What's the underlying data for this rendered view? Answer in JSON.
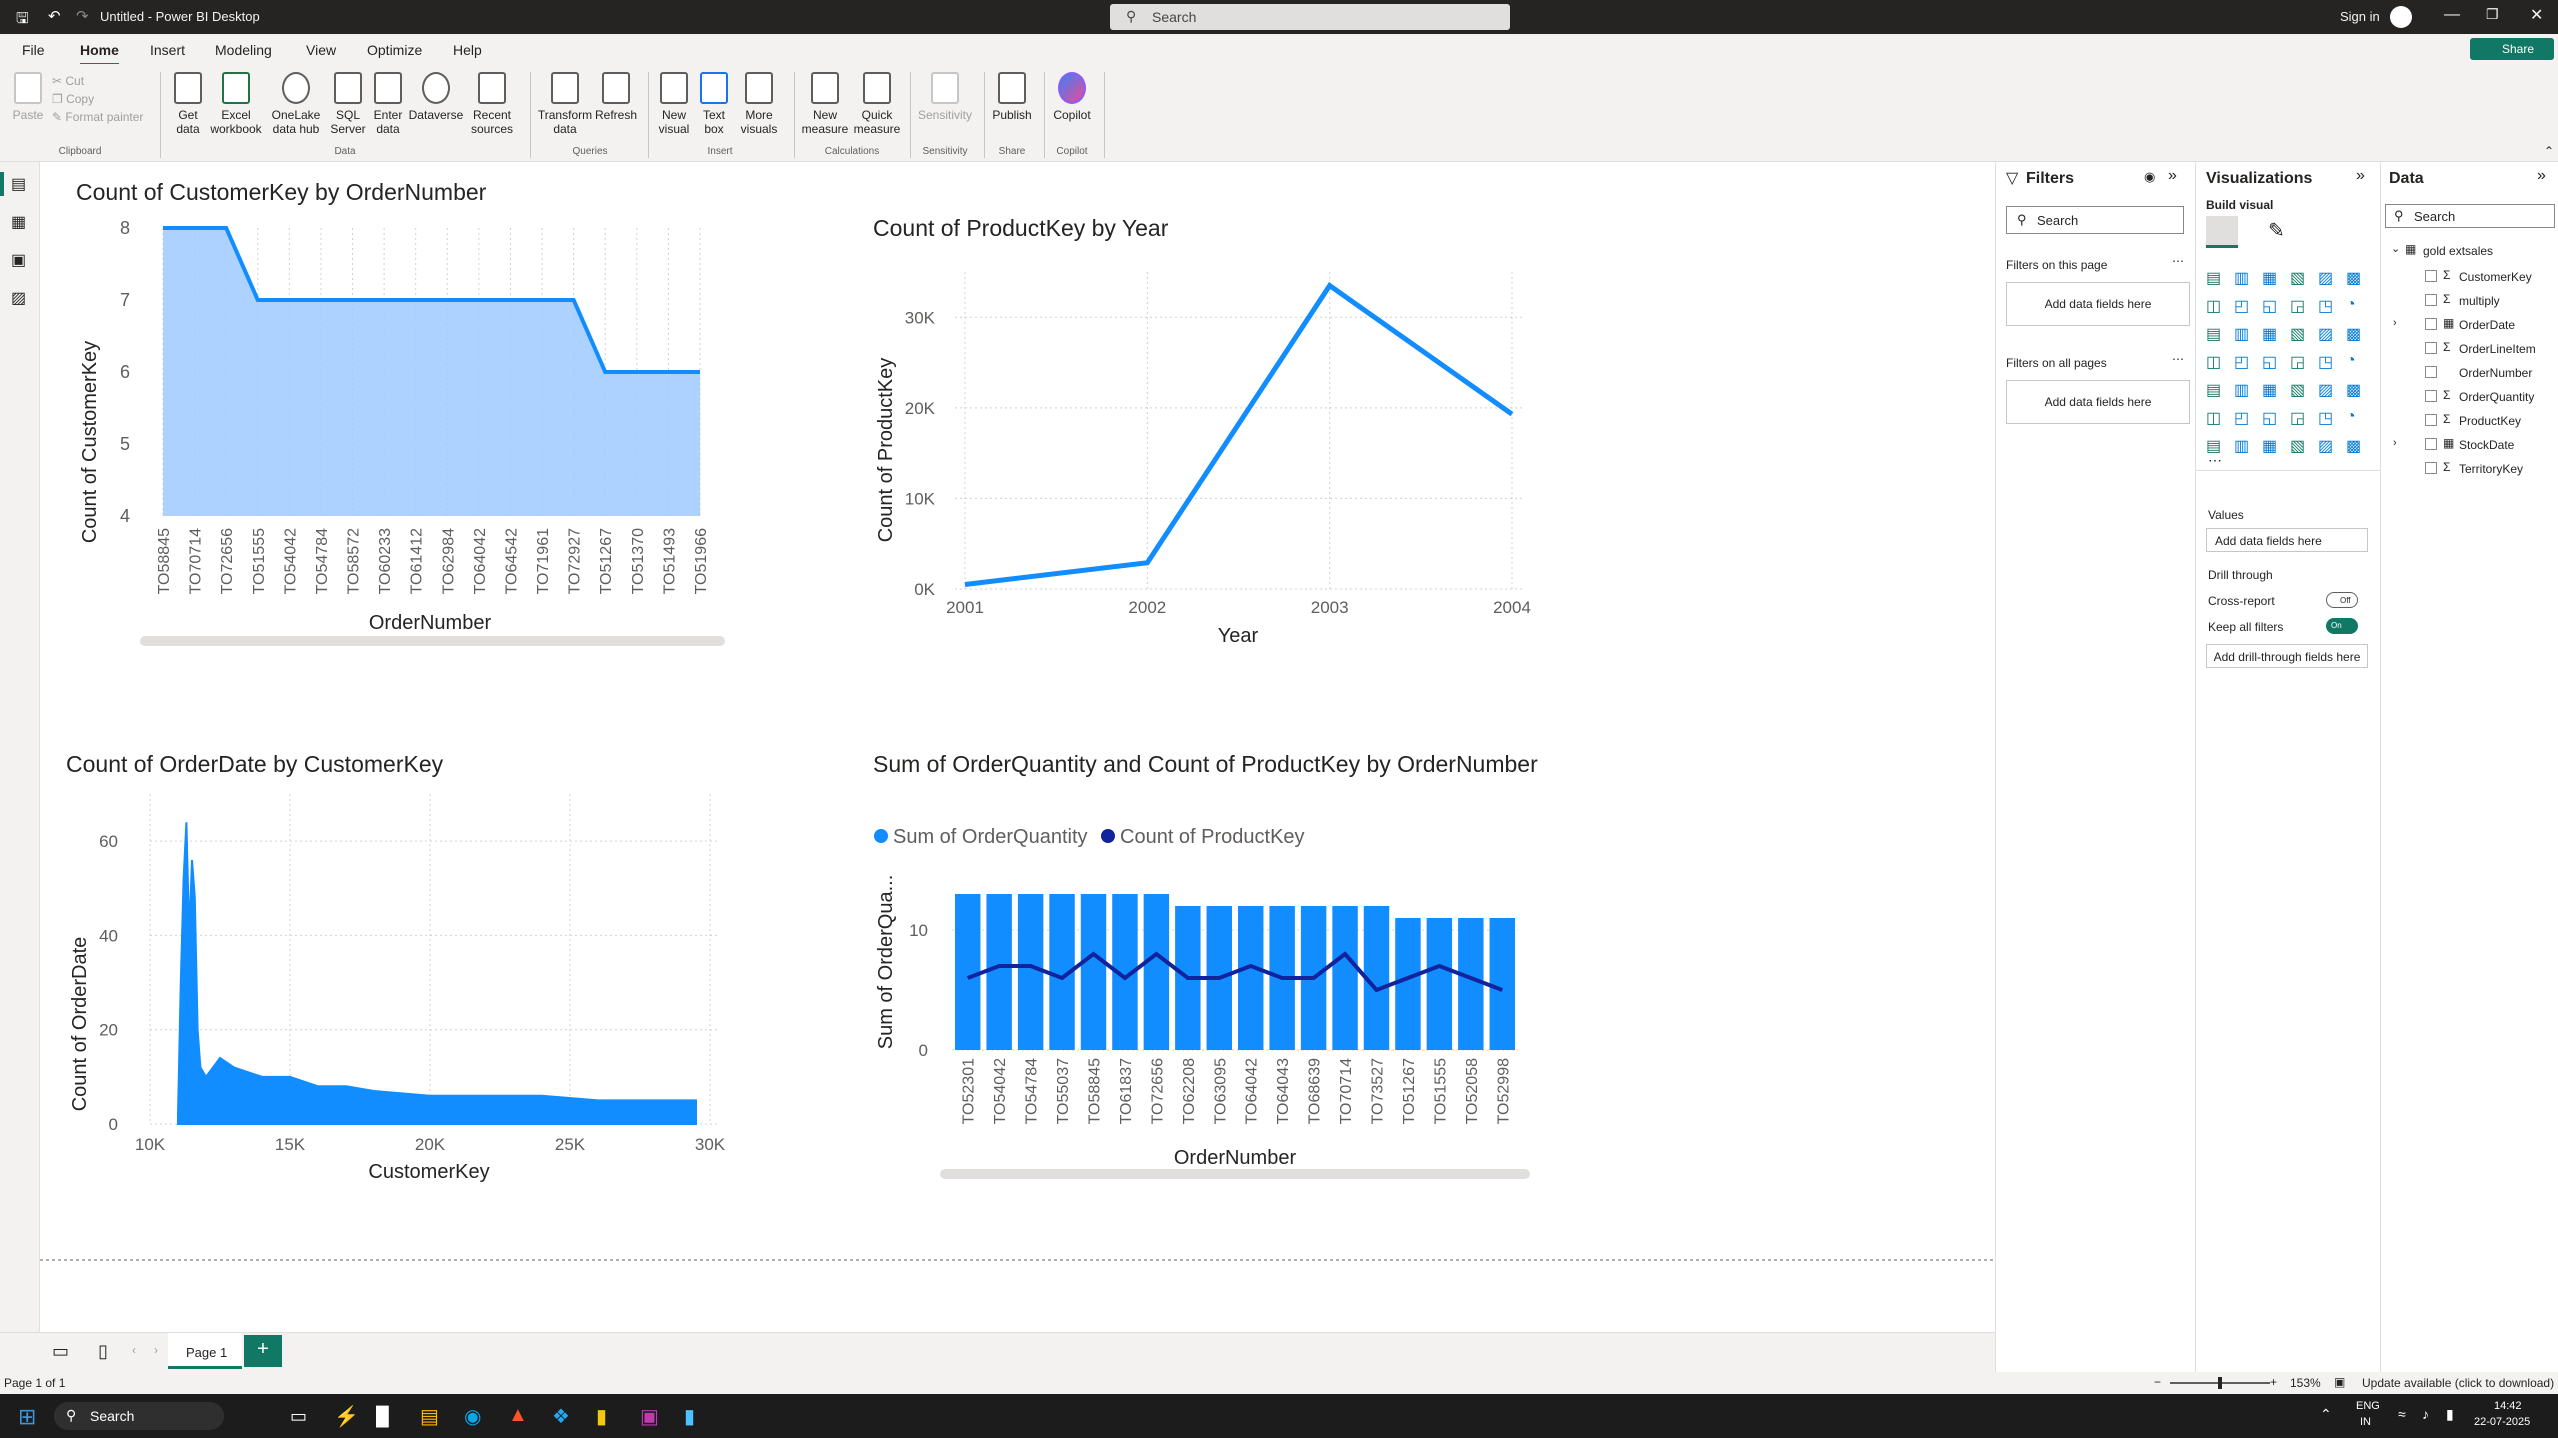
{
  "window": {
    "title": "Untitled - Power BI Desktop",
    "search_placeholder": "Search",
    "sign_in": "Sign in",
    "share": "Share"
  },
  "menu": [
    "File",
    "Home",
    "Insert",
    "Modeling",
    "View",
    "Optimize",
    "Help"
  ],
  "ribbon": {
    "clipboard": {
      "paste": "Paste",
      "cut": "Cut",
      "copy": "Copy",
      "format_painter": "Format painter",
      "group": "Clipboard"
    },
    "data": {
      "items": [
        "Get data",
        "Excel workbook",
        "OneLake data hub",
        "SQL Server",
        "Enter data",
        "Dataverse",
        "Recent sources"
      ],
      "group": "Data"
    },
    "queries": {
      "items": [
        "Transform data",
        "Refresh"
      ],
      "group": "Queries"
    },
    "insert": {
      "items": [
        "New visual",
        "Text box",
        "More visuals"
      ],
      "group": "Insert"
    },
    "calculations": {
      "items": [
        "New measure",
        "Quick measure"
      ],
      "group": "Calculations"
    },
    "sensitivity": {
      "items": [
        "Sensitivity"
      ],
      "group": "Sensitivity"
    },
    "share": {
      "items": [
        "Publish"
      ],
      "group": "Share"
    },
    "copilot": {
      "items": [
        "Copilot"
      ],
      "group": "Copilot"
    }
  },
  "charts": {
    "c1": {
      "title": "Count of CustomerKey by OrderNumber",
      "xlabel": "OrderNumber",
      "ylabel": "Count of CustomerKey",
      "yticks": [
        "8",
        "7",
        "6",
        "5",
        "4"
      ]
    },
    "c2": {
      "title": "Count of ProductKey by Year",
      "xlabel": "Year",
      "ylabel": "Count of ProductKey",
      "yticks": [
        "30K",
        "20K",
        "10K",
        "0K"
      ],
      "xticks": [
        "2001",
        "2002",
        "2003",
        "2004"
      ]
    },
    "c3": {
      "title": "Count of OrderDate by CustomerKey",
      "xlabel": "CustomerKey",
      "ylabel": "Count of OrderDate",
      "yticks": [
        "60",
        "40",
        "20",
        "0"
      ],
      "xticks": [
        "10K",
        "15K",
        "20K",
        "25K",
        "30K"
      ]
    },
    "c4": {
      "title": "Sum of OrderQuantity and Count of ProductKey by OrderNumber",
      "xlabel": "OrderNumber",
      "ylabel": "Sum of OrderQua...",
      "yticks": [
        "10",
        "0"
      ],
      "legend": [
        "Sum of OrderQuantity",
        "Count of ProductKey"
      ]
    }
  },
  "chart_data": [
    {
      "type": "area",
      "title": "Count of CustomerKey by OrderNumber",
      "xlabel": "OrderNumber",
      "ylabel": "Count of CustomerKey",
      "categories": [
        "TO58845",
        "TO70714",
        "TO72656",
        "TO51555",
        "TO54042",
        "TO54784",
        "TO58572",
        "TO60233",
        "TO61412",
        "TO62984",
        "TO64042",
        "TO64542",
        "TO71961",
        "TO72927",
        "TO51267",
        "TO51370",
        "TO51493",
        "TO51966"
      ],
      "values": [
        8,
        8,
        8,
        7,
        7,
        7,
        7,
        7,
        7,
        7,
        7,
        7,
        7,
        7,
        6,
        6,
        6,
        6
      ],
      "ylim": [
        4,
        8
      ]
    },
    {
      "type": "line",
      "title": "Count of ProductKey by Year",
      "xlabel": "Year",
      "ylabel": "Count of ProductKey",
      "x": [
        2001,
        2002,
        2003,
        2004
      ],
      "values": [
        500,
        2900,
        33500,
        19300
      ],
      "ylim": [
        0,
        35000
      ]
    },
    {
      "type": "area",
      "title": "Count of OrderDate by CustomerKey",
      "xlabel": "CustomerKey",
      "ylabel": "Count of OrderDate",
      "x": [
        11000,
        11100,
        11200,
        11300,
        11400,
        11500,
        11600,
        11700,
        11800,
        12000,
        12500,
        13000,
        13500,
        14000,
        15000,
        16000,
        17000,
        18000,
        20000,
        22000,
        24000,
        26000,
        28000,
        29500
      ],
      "values": [
        2,
        30,
        52,
        64,
        40,
        56,
        48,
        20,
        12,
        10,
        14,
        12,
        11,
        10,
        10,
        8,
        8,
        7,
        6,
        6,
        6,
        5,
        5,
        5
      ],
      "xlim": [
        10000,
        30000
      ],
      "ylim": [
        0,
        70
      ]
    },
    {
      "type": "bar",
      "title": "Sum of OrderQuantity and Count of ProductKey by OrderNumber",
      "xlabel": "OrderNumber",
      "ylabel": "Sum of OrderQua...",
      "categories": [
        "TO52301",
        "TO54042",
        "TO54784",
        "TO55037",
        "TO58845",
        "TO61837",
        "TO72656",
        "TO62208",
        "TO63095",
        "TO64042",
        "TO64043",
        "TO68639",
        "TO70714",
        "TO73527",
        "TO51267",
        "TO51555",
        "TO52058",
        "TO52998"
      ],
      "series": [
        {
          "name": "Sum of OrderQuantity",
          "values": [
            13,
            13,
            13,
            13,
            13,
            13,
            13,
            12,
            12,
            12,
            12,
            12,
            12,
            12,
            11,
            11,
            11,
            11
          ]
        },
        {
          "name": "Count of ProductKey",
          "values": [
            6,
            7,
            7,
            6,
            8,
            6,
            8,
            6,
            6,
            7,
            6,
            6,
            8,
            5,
            6,
            7,
            6,
            5
          ]
        }
      ],
      "ylim": [
        0,
        14
      ]
    }
  ],
  "filters": {
    "title": "Filters",
    "search": "Search",
    "on_page": "Filters on this page",
    "on_all": "Filters on all pages",
    "add": "Add data fields here"
  },
  "viz": {
    "title": "Visualizations",
    "build": "Build visual",
    "values": "Values",
    "add_values": "Add data fields here",
    "drill": "Drill through",
    "cross": "Cross-report",
    "cross_state": "Off",
    "keep": "Keep all filters",
    "keep_state": "On",
    "add_drill": "Add drill-through fields here"
  },
  "data": {
    "title": "Data",
    "search": "Search",
    "table": "gold extsales",
    "fields": [
      {
        "name": "CustomerKey",
        "sigma": true
      },
      {
        "name": "multiply",
        "sigma": true
      },
      {
        "name": "OrderDate",
        "sigma": false,
        "expand": true
      },
      {
        "name": "OrderLineItem",
        "sigma": true
      },
      {
        "name": "OrderNumber",
        "sigma": false
      },
      {
        "name": "OrderQuantity",
        "sigma": true
      },
      {
        "name": "ProductKey",
        "sigma": true
      },
      {
        "name": "StockDate",
        "sigma": false,
        "expand": true
      },
      {
        "name": "TerritoryKey",
        "sigma": true
      }
    ]
  },
  "pages": {
    "tab": "Page 1",
    "status": "Page 1 of 1"
  },
  "status": {
    "zoom": "153%",
    "update": "Update available (click to download)"
  },
  "taskbar": {
    "search": "Search",
    "lang": "ENG",
    "region": "IN",
    "time": "14:42",
    "date": "22-07-2025"
  }
}
